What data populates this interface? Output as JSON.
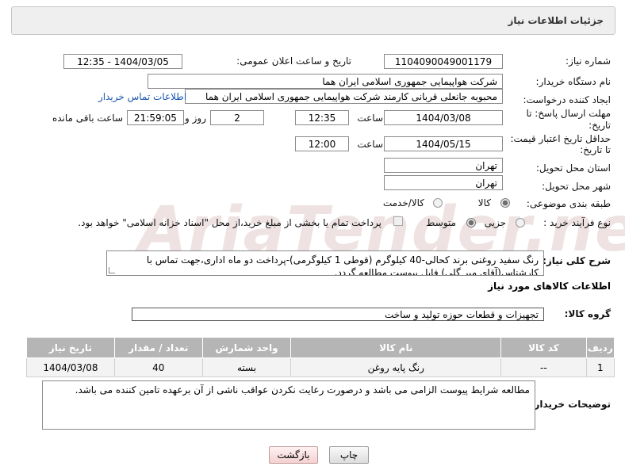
{
  "header": {
    "title": "جزئیات اطلاعات نیاز"
  },
  "fields": {
    "need_number": {
      "label": "شماره نیاز:",
      "value": "1104090049001179"
    },
    "announce_datetime": {
      "label": "تاریخ و ساعت اعلان عمومی:",
      "value": "1404/03/05 - 12:35"
    },
    "buyer_org": {
      "label": "نام دستگاه خریدار:",
      "value": "شرکت هواپیمایی جمهوری اسلامی ایران هما"
    },
    "requester": {
      "label": "ایجاد کننده درخواست:",
      "value": "محبوبه جانعلی قربانی کارمند شرکت هواپیمایی جمهوری اسلامی ایران هما",
      "contact_link": "اطلاعات تماس خریدار"
    },
    "reply_deadline": {
      "label_line1": "مهلت ارسال پاسخ: تا",
      "label_line2": "تاریخ:",
      "date": "1404/03/08",
      "time_label": "ساعت",
      "time": "12:35",
      "days": "2",
      "days_label": "روز و",
      "remaining": "21:59:05",
      "remaining_label": "ساعت باقی مانده"
    },
    "price_validity": {
      "label_line1": "حداقل تاریخ اعتبار قیمت:",
      "label_line2": "تا تاریخ:",
      "date": "1404/05/15",
      "time_label": "ساعت",
      "time": "12:00"
    },
    "delivery_province": {
      "label": "استان محل تحویل:",
      "value": "تهران"
    },
    "delivery_city": {
      "label": "شهر محل تحویل:",
      "value": "تهران"
    },
    "category": {
      "label": "طبقه بندی موضوعی:",
      "options": [
        "کالا",
        "کالا/خدمت"
      ],
      "selected": "کالا"
    },
    "purchase_process": {
      "label": "نوع فرآیند خرید :",
      "options": [
        "جزیی",
        "متوسط"
      ],
      "selected": "متوسط",
      "note": "پرداخت تمام یا بخشی از مبلغ خرید،از محل \"اسناد خزانه اسلامی\" خواهد بود."
    }
  },
  "description": {
    "label": "شرح کلی نیاز:",
    "text": "رنگ سفید روغنی برند کحالی-40 کیلوگرم (قوطی 1 کیلوگرمی)-پرداخت دو  ماه اداری،جهت تماس با کارشناس(آقای میر گلی) فایل پیوست مطالعه گردد."
  },
  "items_section": {
    "title": "اطلاعات کالاهای مورد نیاز",
    "group_label": "گروه کالا:",
    "group_value": "تجهیزات و قطعات حوزه تولید و ساخت",
    "columns": [
      "ردیف",
      "کد کالا",
      "نام کالا",
      "واحد شمارش",
      "تعداد / مقدار",
      "تاریخ نیاز"
    ],
    "rows": [
      {
        "index": "1",
        "code": "--",
        "name": "رنگ پایه روغن",
        "unit": "بسته",
        "qty": "40",
        "date": "1404/03/08"
      }
    ]
  },
  "buyer_notes": {
    "label": "توضیحات خریدار:",
    "text": "مطالعه شرایط پیوست الزامی می باشد و درصورت رعایت نکردن عواقب ناشی از آن برعهده تامین کننده می باشد."
  },
  "buttons": {
    "print": "چاپ",
    "back": "بازگشت"
  },
  "watermark": "AriaTender.neT"
}
